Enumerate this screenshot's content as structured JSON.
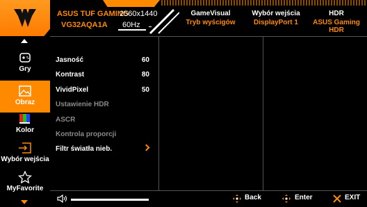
{
  "header": {
    "model_name": "ASUS TUF GAMING",
    "model_code": "VG32AQA1A",
    "resolution": "2560x1440",
    "refresh": "60Hz",
    "info": [
      {
        "title": "GameVisual",
        "value": "Tryb wyścigów"
      },
      {
        "title": "Wybór wejścia",
        "value": "DisplayPort 1"
      },
      {
        "title": "HDR",
        "value": "ASUS Gaming HDR"
      }
    ]
  },
  "sidebar": {
    "items": [
      {
        "label": "Gry",
        "icon": "gamepad-icon"
      },
      {
        "label": "Obraz",
        "icon": "image-icon",
        "active": true
      },
      {
        "label": "Kolor",
        "icon": "color-palette-icon"
      },
      {
        "label": "Wybór wejścia",
        "icon": "input-select-icon"
      },
      {
        "label": "MyFavorite",
        "icon": "star-icon"
      }
    ]
  },
  "menu": {
    "items": [
      {
        "label": "Jasność",
        "value": "60",
        "enabled": true
      },
      {
        "label": "Kontrast",
        "value": "80",
        "enabled": true
      },
      {
        "label": "VividPixel",
        "value": "50",
        "enabled": true
      },
      {
        "label": "Ustawienie HDR",
        "value": "",
        "enabled": false
      },
      {
        "label": "ASCR",
        "value": "",
        "enabled": false
      },
      {
        "label": "Kontrola proporcji",
        "value": "",
        "enabled": false
      },
      {
        "label": "Filtr światła nieb.",
        "value": "",
        "enabled": true
      }
    ]
  },
  "bottom": {
    "back": "Back",
    "enter": "Enter",
    "exit": "EXIT"
  },
  "colors": {
    "accent": "#ff8a00",
    "background": "#000000",
    "dim_text": "#8a8a8a"
  }
}
